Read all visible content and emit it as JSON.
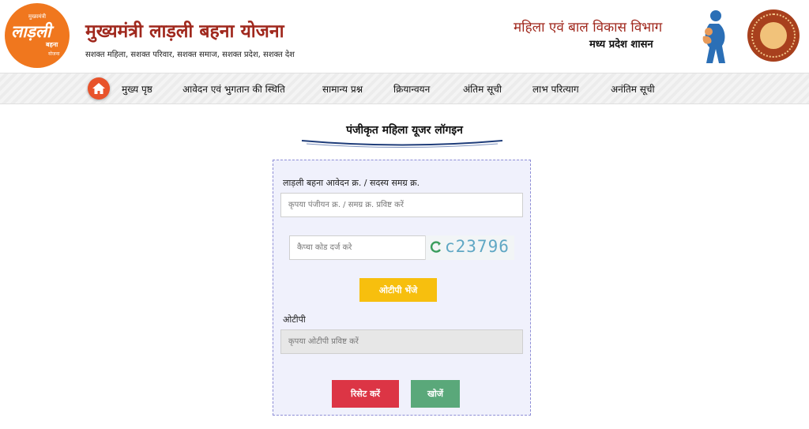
{
  "header": {
    "logo": {
      "top_text": "मुख्यमंत्री",
      "main_text": "लाड़ली",
      "mid_text": "बहना",
      "bottom_text": "योजना"
    },
    "title": "मुख्यमंत्री लाड़ली बहना योजना",
    "tagline": "सशक्त महिला, सशक्त परिवार, सशक्त समाज, सशक्त प्रदेश, सशक्त देश",
    "department": "महिला एवं बाल विकास विभाग",
    "government": "मध्य प्रदेश शासन"
  },
  "nav": {
    "home_icon": "home-icon",
    "items": [
      "मुख्य पृष्ठ",
      "आवेदन एवं भुगतान की स्थिति",
      "सामान्य प्रश्न",
      "क्रियान्वयन",
      "अंतिम सूची",
      "लाभ परित्याग",
      "अनंतिम सूची"
    ]
  },
  "login": {
    "heading": "पंजीकृत महिला यूजर लॉगइन",
    "application_label": "लाड़ली बहना आवेदन क्र. / सदस्य समग्र क्र.",
    "application_placeholder": "कृपया पंजीयन क्र. / समग्र क्र. प्रविष्ट करें",
    "captcha_placeholder": "कैप्चा कोड दर्ज करे",
    "captcha_code": "c23796",
    "send_otp_label": "ओटीपी भेंजे",
    "otp_label": "ओटीपी",
    "otp_placeholder": "कृपया ओटीपी प्रविष्ट करें",
    "reset_label": "रिसेट करें",
    "search_label": "खोजें"
  },
  "colors": {
    "brand_orange": "#f0771e",
    "title_red": "#a0281d",
    "otp_button": "#f7bf0e",
    "reset_button": "#dc3545",
    "search_button": "#5aa87a",
    "form_background": "#f0f1fc"
  }
}
